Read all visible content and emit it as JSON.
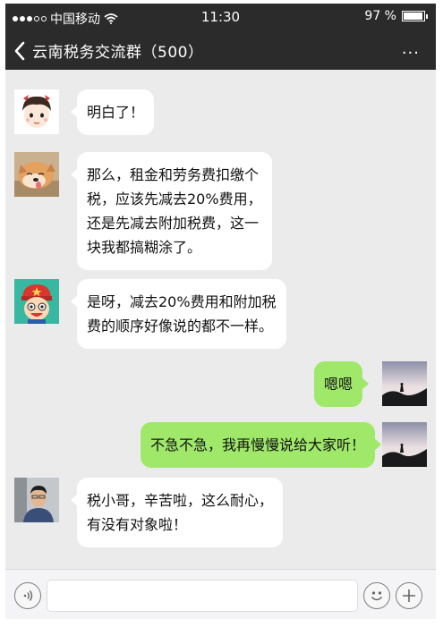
{
  "status_bar": {
    "carrier": "中国移动",
    "time": "11:30",
    "battery": "97 %",
    "battery_level": 0.97
  },
  "nav": {
    "title": "云南税务交流群（500）",
    "more": "..."
  },
  "messages": [
    {
      "sender": "other",
      "avatar": "cartoon-girl-avatar",
      "text": "明白了！"
    },
    {
      "sender": "other",
      "avatar": "dog-photo-avatar",
      "text": "那么，租金和劳务费扣缴个\n税，应该先减去20%费用，\n还是先减去附加税费，这一\n块我都搞糊涂了。"
    },
    {
      "sender": "other",
      "avatar": "cartoon-boy-avatar",
      "text": "是呀，减去20%费用和附加税\n费的顺序好像说的都不一样。"
    },
    {
      "sender": "me",
      "avatar": "sunset-hiker-avatar",
      "text": "嗯嗯"
    },
    {
      "sender": "me",
      "avatar": "sunset-hiker-avatar",
      "text": "不急不急，我再慢慢说给大家听！"
    },
    {
      "sender": "other",
      "avatar": "man-photo-avatar",
      "text": "税小哥，辛苦啦，这么耐心，\n有没有对象啦！"
    }
  ],
  "input_bar": {
    "voice_icon": "voice-icon",
    "emoji_icon": "emoji-icon",
    "plus_icon": "plus-icon",
    "value": ""
  }
}
